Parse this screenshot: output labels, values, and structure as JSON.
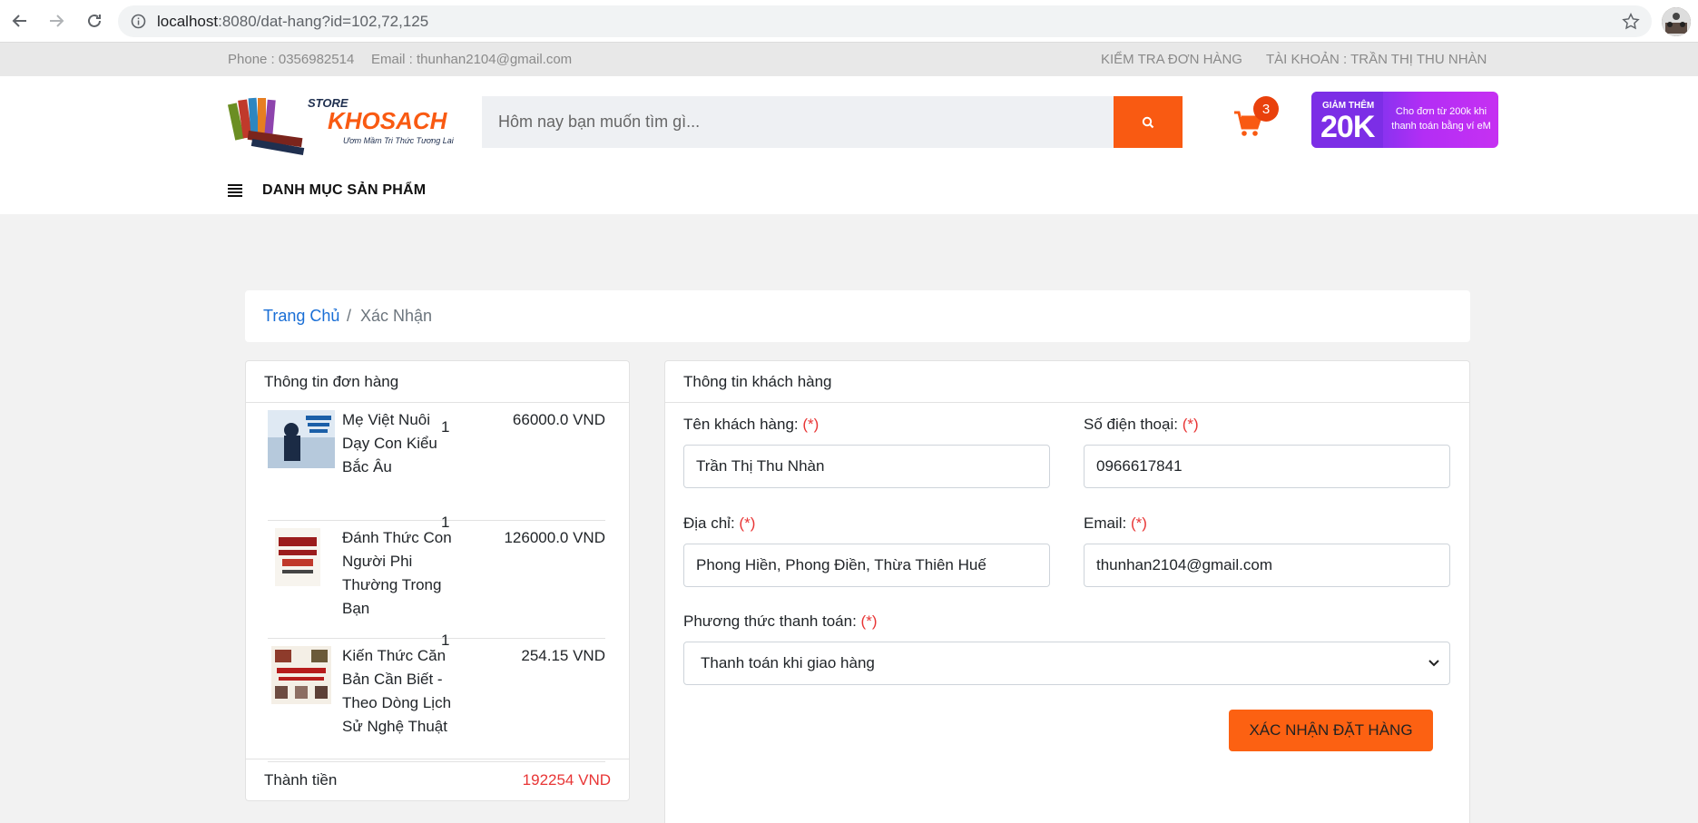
{
  "browser": {
    "url_host": "localhost",
    "url_rest": ":8080/dat-hang?id=102,72,125"
  },
  "top_info": {
    "phone": "Phone : 0356982514",
    "email": "Email : thunhan2104@gmail.com",
    "check_order": "KIỂM TRA ĐƠN HÀNG",
    "account": "TÀI KHOẢN : TRẦN THỊ THU NHÀN"
  },
  "header": {
    "logo_store": "STORE",
    "logo_name": "KHOSACH",
    "logo_slogan": "Ươm Mầm Tri Thức Tương Lai",
    "search_placeholder": "Hôm nay bạn muốn tìm gì...",
    "cart_count": "3",
    "promo_small": "GIẢM THÊM",
    "promo_big": "20K",
    "promo_text": "Cho đơn từ 200k khi thanh toán bằng ví eM",
    "category_label": "DANH MỤC SẢN PHẨM"
  },
  "breadcrumb": {
    "home": "Trang Chủ",
    "separator": "/",
    "current": "Xác Nhận"
  },
  "order": {
    "title": "Thông tin đơn hàng",
    "items": [
      {
        "name": "Mẹ Việt Nuôi Dạy Con Kiểu Bắc Âu",
        "qty": "1",
        "price": "66000.0 VND"
      },
      {
        "name": "Đánh Thức Con Người Phi Thường Trong Bạn",
        "qty": "1",
        "price": "126000.0 VND"
      },
      {
        "name": "Kiến Thức Căn Bản Cần Biết - Theo Dòng Lịch Sử Nghệ Thuật",
        "qty": "1",
        "price": "254.15 VND"
      }
    ],
    "total_label": "Thành tiền",
    "total_value": "192254 VND"
  },
  "customer": {
    "title": "Thông tin khách hàng",
    "name_label": "Tên khách hàng:",
    "name_value": "Trần Thị Thu Nhàn",
    "phone_label": "Số điện thoại:",
    "phone_value": "0966617841",
    "address_label": "Địa chỉ:",
    "address_value": "Phong Hiền, Phong Điền, Thừa Thiên Huế",
    "email_label": "Email:",
    "email_value": "thunhan2104@gmail.com",
    "payment_label": "Phương thức thanh toán:",
    "payment_value": "Thanh toán khi giao hàng",
    "required_mark": "(*)",
    "confirm_button": "XÁC NHẬN ĐẶT HÀNG"
  },
  "colors": {
    "accent": "#f95a12",
    "link": "#1a6fd6",
    "required": "#e83535"
  }
}
